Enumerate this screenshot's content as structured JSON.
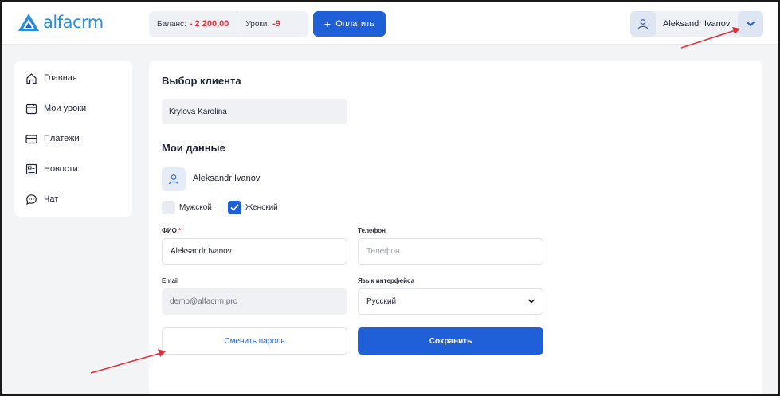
{
  "header": {
    "logo_text": "alfacrm",
    "balance_label": "Баланс:",
    "balance_value": "- 2 200,00",
    "lessons_label": "Уроки:",
    "lessons_value": "-9",
    "pay_button_label": "Оплатить",
    "user_name": "Aleksandr Ivanov"
  },
  "sidebar": {
    "items": [
      {
        "label": "Главная",
        "icon": "home-icon"
      },
      {
        "label": "Мои уроки",
        "icon": "calendar-icon"
      },
      {
        "label": "Платежи",
        "icon": "card-icon"
      },
      {
        "label": "Новости",
        "icon": "news-icon"
      },
      {
        "label": "Чат",
        "icon": "chat-icon"
      }
    ]
  },
  "main": {
    "client_section_title": "Выбор клиента",
    "client_value": "Krylova Karolina",
    "my_data_title": "Мои данные",
    "profile_name": "Aleksandr Ivanov",
    "gender_male_label": "Мужской",
    "gender_female_label": "Женский",
    "gender_female_checked": true,
    "fio_label": "ФИО",
    "fio_required_mark": "*",
    "fio_value": "Aleksandr Ivanov",
    "phone_label": "Телефон",
    "phone_placeholder": "Телефон",
    "email_label": "Email",
    "email_value": "demo@alfacrm.pro",
    "language_label": "Язык интерфейса",
    "language_value": "Русский",
    "change_password_label": "Сменить пароль",
    "save_label": "Сохранить"
  },
  "colors": {
    "accent": "#1f5fd8",
    "negative": "#e0313a",
    "annotation_arrow": "#e0313a",
    "logo": "#2a8fd6"
  }
}
